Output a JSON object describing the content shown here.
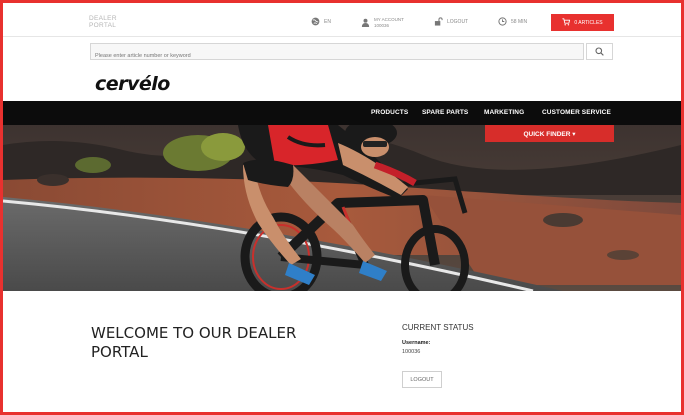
{
  "header": {
    "portal_line1": "DEALER",
    "portal_line2": "PORTAL",
    "language": "EN",
    "account_line1": "MY ACCOUNT",
    "account_line2": "100036",
    "logout": "LOGOUT",
    "timer": "58 MIN",
    "cart": "0 ARTICLES"
  },
  "search": {
    "placeholder": "Please enter article number or keyword"
  },
  "logo": {
    "text": "cervélo"
  },
  "nav": {
    "items": [
      "PRODUCTS",
      "SPARE PARTS",
      "MARKETING",
      "CUSTOMER SERVICE"
    ]
  },
  "quick_finder": "QUICK FINDER ▾",
  "welcome": {
    "title": "WELCOME TO OUR DEALER PORTAL"
  },
  "status": {
    "heading": "CURRENT STATUS",
    "username_label": "Username:",
    "username_value": "100036",
    "logout_button": "LOGOUT"
  },
  "colors": {
    "accent": "#e8312f",
    "nav_bg": "#0c0c0c"
  }
}
